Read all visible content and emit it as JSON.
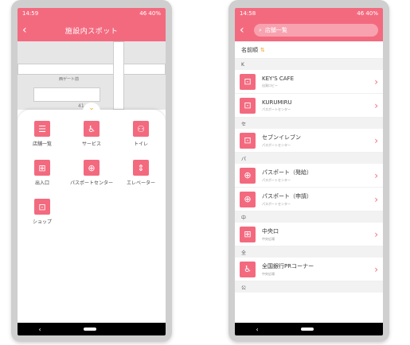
{
  "left": {
    "status": {
      "time": "14:59",
      "right": "46 40%"
    },
    "title": "施設内スポット",
    "map": {
      "label": "西ゲート前",
      "number": "41"
    },
    "grid": [
      {
        "label": "店舗一覧",
        "icon": "list-icon",
        "glyph": "☰"
      },
      {
        "label": "サービス",
        "icon": "service-person-icon",
        "glyph": "♿"
      },
      {
        "label": "トイレ",
        "icon": "restroom-icon",
        "glyph": "⚇"
      },
      {
        "label": "出入口",
        "icon": "door-icon",
        "glyph": "⊞"
      },
      {
        "label": "パスポートセンター",
        "icon": "passport-globe-icon",
        "glyph": "⊕"
      },
      {
        "label": "エレベーター",
        "icon": "elevator-icon",
        "glyph": "⇕"
      },
      {
        "label": "ショップ",
        "icon": "shopping-bag-icon",
        "glyph": "⊡"
      }
    ]
  },
  "right": {
    "status": {
      "time": "14:58",
      "right": "46 40%"
    },
    "search": {
      "text": "店舗一覧"
    },
    "sort_label": "名前順",
    "sections": [
      {
        "header": "K",
        "rows": [
          {
            "name": "KEY'S CAFE",
            "sub": "出発ロビー",
            "icon": "shopping-bag-icon",
            "glyph": "⊡"
          },
          {
            "name": "KURUMIRU",
            "sub": "パスポートセンター",
            "icon": "shopping-bag-icon",
            "glyph": "⊡"
          }
        ]
      },
      {
        "header": "セ",
        "rows": [
          {
            "name": "セブンイレブン",
            "sub": "パスポートセンター",
            "icon": "shopping-bag-icon",
            "glyph": "⊡"
          }
        ]
      },
      {
        "header": "パ",
        "rows": [
          {
            "name": "パスポート（発給）",
            "sub": "パスポートセンター",
            "icon": "passport-globe-icon",
            "glyph": "⊕"
          },
          {
            "name": "パスポート（申請）",
            "sub": "パスポートセンター",
            "icon": "passport-globe-icon",
            "glyph": "⊕"
          }
        ]
      },
      {
        "header": "中",
        "rows": [
          {
            "name": "中央口",
            "sub": "中央広場",
            "icon": "door-icon",
            "glyph": "⊞"
          }
        ]
      },
      {
        "header": "全",
        "rows": [
          {
            "name": "全国銀行PRコーナー",
            "sub": "中央広場",
            "icon": "service-person-icon",
            "glyph": "♿"
          }
        ]
      },
      {
        "header": "公",
        "rows": []
      }
    ]
  },
  "nav": {
    "back": "‹"
  }
}
